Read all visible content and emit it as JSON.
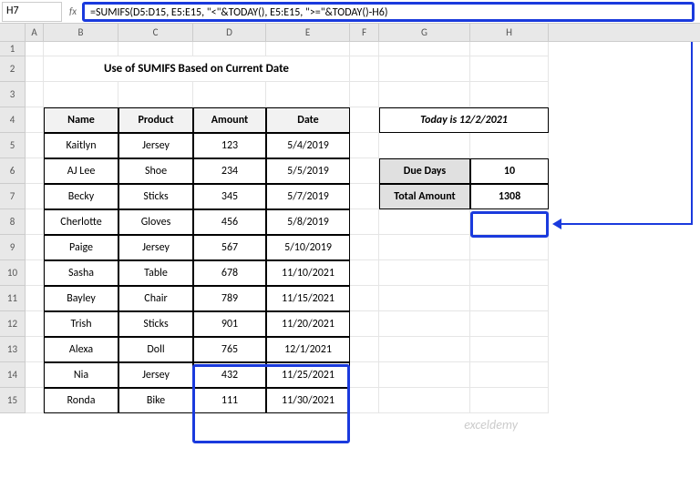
{
  "cellRef": "H7",
  "fx": "fx",
  "formula": "=SUMIFS(D5:D15, E5:E15, \"<\"&TODAY(), E5:E15, \">=\"&TODAY()-H6)",
  "cols": [
    "A",
    "B",
    "C",
    "D",
    "E",
    "F",
    "G",
    "H"
  ],
  "rows": [
    "1",
    "2",
    "3",
    "4",
    "5",
    "6",
    "7",
    "8",
    "9",
    "10",
    "11",
    "12",
    "13",
    "14",
    "15"
  ],
  "title": "Use of SUMIFS Based on Current Date",
  "headers": {
    "name": "Name",
    "product": "Product",
    "amount": "Amount",
    "date": "Date"
  },
  "tbl": [
    {
      "name": "Kaitlyn",
      "product": "Jersey",
      "amount": "123",
      "date": "5/4/2019"
    },
    {
      "name": "AJ Lee",
      "product": "Shoe",
      "amount": "234",
      "date": "5/5/2019"
    },
    {
      "name": "Becky",
      "product": "Sticks",
      "amount": "345",
      "date": "5/7/2019"
    },
    {
      "name": "Cherlotte",
      "product": "Gloves",
      "amount": "456",
      "date": "5/8/2019"
    },
    {
      "name": "Paige",
      "product": "Jersey",
      "amount": "567",
      "date": "5/10/2019"
    },
    {
      "name": "Sasha",
      "product": "Table",
      "amount": "678",
      "date": "11/10/2021"
    },
    {
      "name": "Bayley",
      "product": "Chair",
      "amount": "789",
      "date": "11/15/2021"
    },
    {
      "name": "Trish",
      "product": "Sticks",
      "amount": "901",
      "date": "11/20/2021"
    },
    {
      "name": "Alexa",
      "product": "Doll",
      "amount": "765",
      "date": "12/1/2021"
    },
    {
      "name": "Nia",
      "product": "Jersey",
      "amount": "432",
      "date": "11/25/2021"
    },
    {
      "name": "Ronda",
      "product": "Bike",
      "amount": "111",
      "date": "11/30/2021"
    }
  ],
  "side": {
    "today": "Today is 12/2/2021",
    "dueDaysLabel": "Due Days",
    "dueDaysVal": "10",
    "totalLabel": "Total Amount",
    "totalVal": "1308"
  },
  "watermark": "exceldemy"
}
